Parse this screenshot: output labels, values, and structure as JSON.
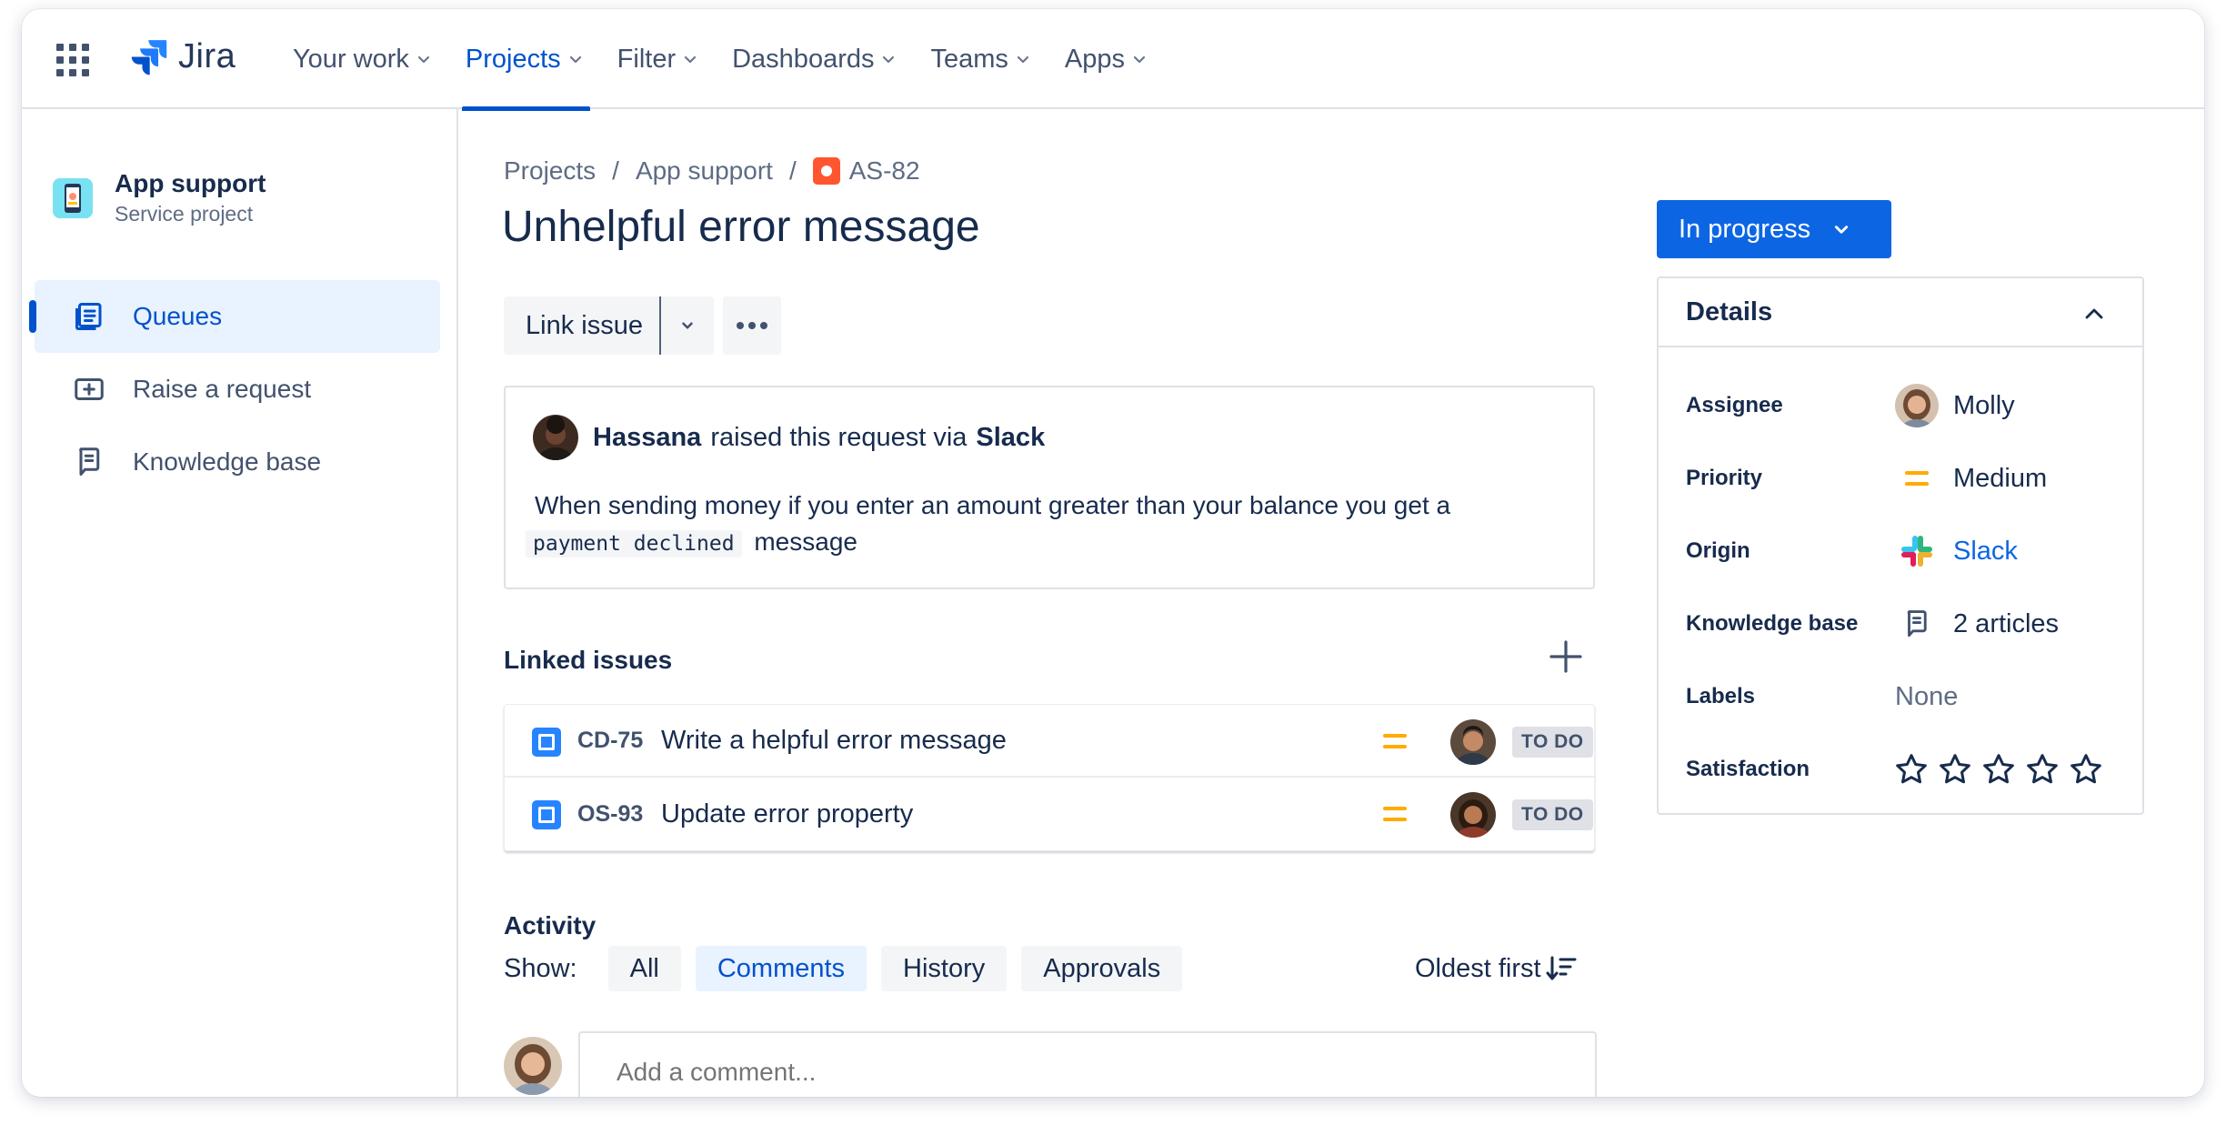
{
  "nav": {
    "logo_text": "Jira",
    "items": [
      {
        "label": "Your work"
      },
      {
        "label": "Projects"
      },
      {
        "label": "Filter"
      },
      {
        "label": "Dashboards"
      },
      {
        "label": "Teams"
      },
      {
        "label": "Apps"
      }
    ],
    "active_item": "Projects"
  },
  "sidebar": {
    "project_name": "App support",
    "project_type": "Service project",
    "items": [
      {
        "label": "Queues",
        "icon": "queues-icon"
      },
      {
        "label": "Raise a request",
        "icon": "raise-request-icon"
      },
      {
        "label": "Knowledge base",
        "icon": "knowledge-base-icon"
      }
    ],
    "active_item": "Queues"
  },
  "breadcrumb": {
    "items": [
      "Projects",
      "App support"
    ],
    "issue_key": "AS-82"
  },
  "issue": {
    "title": "Unhelpful error message",
    "link_issue_label": "Link issue"
  },
  "request": {
    "reporter": "Hassana",
    "middle_text": "raised this request via",
    "channel": "Slack",
    "body_before": "When sending money if you enter an amount greater than your balance you get a",
    "body_code": "payment declined",
    "body_after": "message"
  },
  "linked_issues": {
    "title": "Linked issues",
    "items": [
      {
        "key": "CD-75",
        "summary": "Write a helpful error message",
        "status": "TO DO"
      },
      {
        "key": "OS-93",
        "summary": "Update error property",
        "status": "TO DO"
      }
    ]
  },
  "activity": {
    "title": "Activity",
    "show_label": "Show:",
    "filters": [
      "All",
      "Comments",
      "History",
      "Approvals"
    ],
    "selected_filter": "Comments",
    "sort_label": "Oldest first",
    "comment_placeholder": "Add a comment..."
  },
  "status": {
    "label": "In progress",
    "color": "#0C66E4"
  },
  "details": {
    "title": "Details",
    "assignee_label": "Assignee",
    "assignee_value": "Molly",
    "priority_label": "Priority",
    "priority_value": "Medium",
    "origin_label": "Origin",
    "origin_value": "Slack",
    "kb_label": "Knowledge base",
    "kb_value": "2 articles",
    "labels_label": "Labels",
    "labels_value": "None",
    "satisfaction_label": "Satisfaction",
    "satisfaction_rating": 0,
    "satisfaction_max": 5
  },
  "colors": {
    "brand": "#0052CC",
    "priority_medium": "#FFAB00",
    "bug": "#FF5630",
    "task": "#2684FF"
  }
}
